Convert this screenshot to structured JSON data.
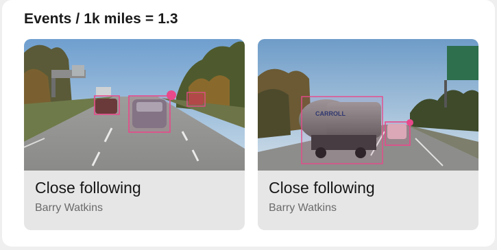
{
  "panel": {
    "title": "Events / 1k miles = 1.3"
  },
  "events": [
    {
      "title": "Close following",
      "driver": "Barry Watkins",
      "thumbnail_icon": "dashcam-thumbnail-icon"
    },
    {
      "title": "Close following",
      "driver": "Barry Watkins",
      "thumbnail_icon": "dashcam-thumbnail-icon",
      "truck_lettering": "CARROLL"
    }
  ],
  "colors": {
    "detection_box": "#e8498a",
    "card_background": "#e6e6e6"
  }
}
